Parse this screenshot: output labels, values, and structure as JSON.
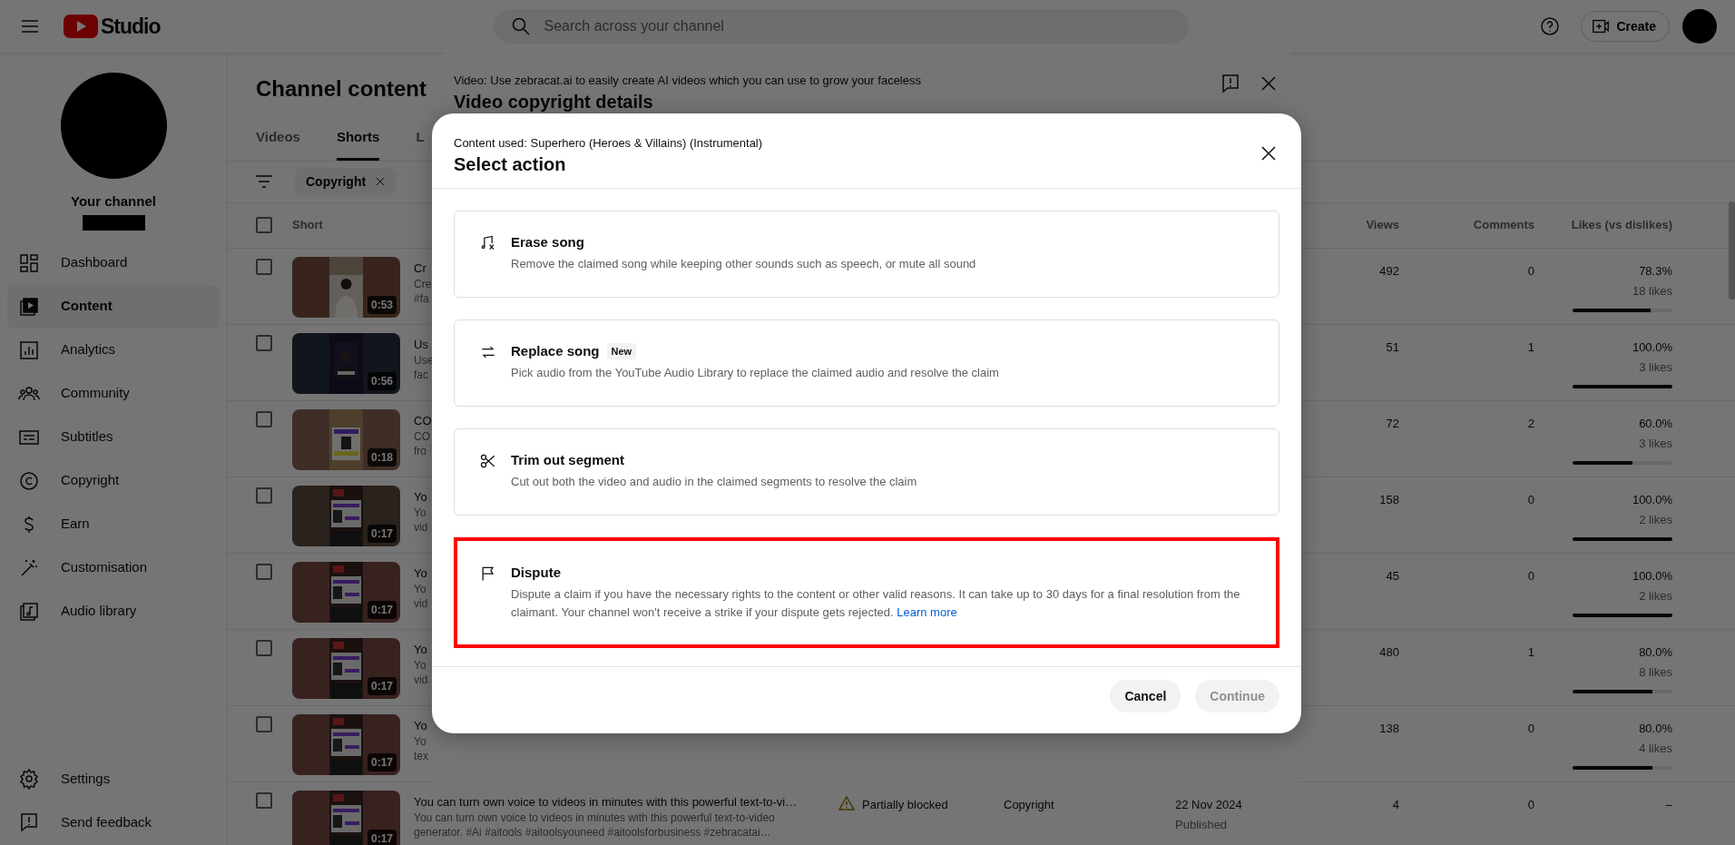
{
  "topbar": {
    "logo_text": "Studio",
    "search": {
      "placeholder": "Search across your channel"
    },
    "create_label": "Create"
  },
  "sidebar": {
    "channel_label": "Your channel",
    "items": [
      {
        "label": "Dashboard",
        "selected": false
      },
      {
        "label": "Content",
        "selected": true
      },
      {
        "label": "Analytics",
        "selected": false
      },
      {
        "label": "Community",
        "selected": false
      },
      {
        "label": "Subtitles",
        "selected": false
      },
      {
        "label": "Copyright",
        "selected": false
      },
      {
        "label": "Earn",
        "selected": false
      },
      {
        "label": "Customisation",
        "selected": false
      },
      {
        "label": "Audio library",
        "selected": false
      }
    ],
    "footer_items": [
      {
        "label": "Settings"
      },
      {
        "label": "Send feedback"
      }
    ]
  },
  "page": {
    "title": "Channel content",
    "tabs": [
      {
        "label": "Videos",
        "selected": false
      },
      {
        "label": "Shorts",
        "selected": true
      },
      {
        "label": "L",
        "selected": false
      }
    ],
    "filter_chip": "Copyright"
  },
  "table": {
    "header_checked": false,
    "columns": [
      "Short",
      "Views",
      "Comments",
      "Likes (vs dislikes)"
    ],
    "rows": [
      {
        "checked": false,
        "duration": "0:53",
        "title": "Cr",
        "description": [
          "Cre",
          "#fa"
        ],
        "views": "492",
        "comments": "0",
        "likes_percent": "78.3%",
        "likes_count": "18 likes",
        "level": 0.783
      },
      {
        "checked": false,
        "duration": "0:56",
        "title": "Us",
        "description": [
          "Use",
          "fac"
        ],
        "views": "51",
        "comments": "1",
        "likes_percent": "100.0%",
        "likes_count": "3 likes",
        "level": 1
      },
      {
        "checked": false,
        "duration": "0:18",
        "title": "CO",
        "description": [
          "CO",
          "fro"
        ],
        "views": "72",
        "comments": "2",
        "likes_percent": "60.0%",
        "likes_count": "3 likes",
        "level": 0.6
      },
      {
        "checked": false,
        "duration": "0:17",
        "title": "Yo",
        "description": [
          "Yo",
          "vid"
        ],
        "views": "158",
        "comments": "0",
        "likes_percent": "100.0%",
        "likes_count": "2 likes",
        "level": 1
      },
      {
        "checked": false,
        "duration": "0:17",
        "title": "Yo",
        "description": [
          "Yo",
          "vid"
        ],
        "views": "45",
        "comments": "0",
        "likes_percent": "100.0%",
        "likes_count": "2 likes",
        "level": 1
      },
      {
        "checked": false,
        "duration": "0:17",
        "title": "Yo",
        "description": [
          "Yo",
          "vid"
        ],
        "views": "480",
        "comments": "1",
        "likes_percent": "80.0%",
        "likes_count": "8 likes",
        "level": 0.8
      },
      {
        "checked": false,
        "duration": "0:17",
        "title": "Yo",
        "description": [
          "Yo",
          "tex"
        ],
        "views": "138",
        "comments": "0",
        "likes_percent": "80.0%",
        "likes_count": "4 likes",
        "level": 0.8
      },
      {
        "checked": false,
        "duration": "0:17",
        "title": "You can turn own voice to videos in minutes with this powerful text-to-vi…",
        "description": [
          "You can turn own voice to videos in minutes with this powerful text-to-video",
          "generator. #Ai #aitools #aitoolsyouneed #aitoolsforbusiness #zebracatai…"
        ],
        "restriction": "Partially blocked",
        "restriction_type": "Copyright",
        "date": "22 Nov 2024",
        "date_status": "Published",
        "views": "4",
        "comments": "0",
        "likes_percent": "–"
      }
    ]
  },
  "back_dialog": {
    "video_line": "Video: Use zebracat.ai to easily create AI videos which you can use to grow your faceless",
    "title": "Video copyright details"
  },
  "dialog": {
    "content_line": "Content used: Superhero (Heroes & Villains) (Instrumental)",
    "title": "Select action",
    "options": [
      {
        "title": "Erase song",
        "description": "Remove the claimed song while keeping other sounds such as speech, or mute all sound",
        "highlighted": false
      },
      {
        "title": "Replace song",
        "badge": "New",
        "description": "Pick audio from the YouTube Audio Library to replace the claimed audio and resolve the claim",
        "highlighted": false
      },
      {
        "title": "Trim out segment",
        "description": "Cut out both the video and audio in the claimed segments to resolve the claim",
        "highlighted": false
      },
      {
        "title": "Dispute",
        "description": "Dispute a claim if you have the necessary rights to the content or other valid reasons. It can take up to 30 days for a final resolution from the claimant. Your channel won't receive a strike if your dispute gets rejected.",
        "link": "Learn more",
        "highlighted": true
      }
    ],
    "buttons": [
      {
        "label": "Cancel",
        "disabled": false
      },
      {
        "label": "Continue",
        "disabled": true
      }
    ]
  }
}
